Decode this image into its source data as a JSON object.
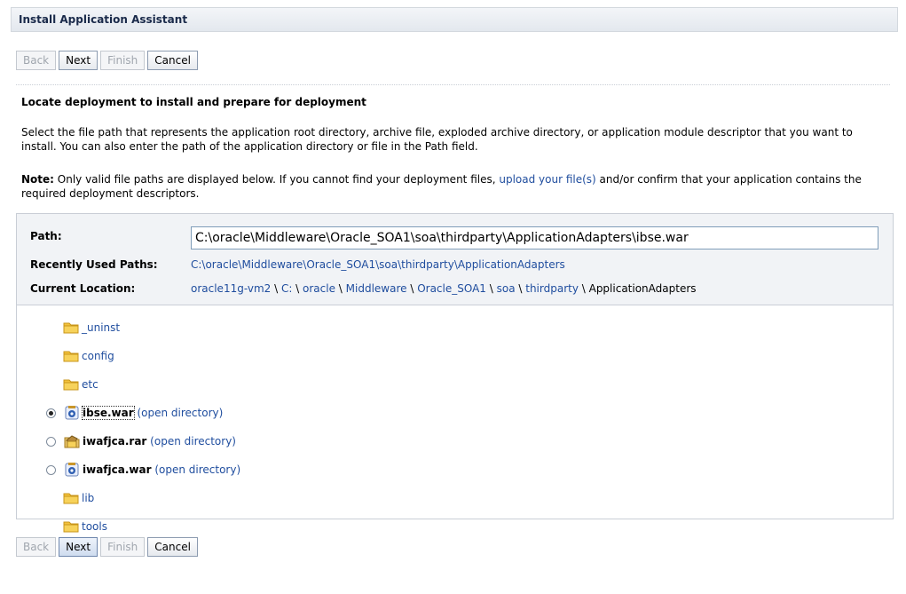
{
  "title": "Install Application Assistant",
  "buttons": {
    "back": "Back",
    "next": "Next",
    "finish": "Finish",
    "cancel": "Cancel"
  },
  "heading": "Locate deployment to install and prepare for deployment",
  "intro": "Select the file path that represents the application root directory, archive file, exploded archive directory, or application module descriptor that you want to install. You can also enter the path of the application directory or file in the Path field.",
  "note": {
    "label": "Note:",
    "text_before": " Only valid file paths are displayed below. If you cannot find your deployment files, ",
    "link": "upload your file(s)",
    "text_after": " and/or confirm that your application contains the required deployment descriptors."
  },
  "path": {
    "label": "Path:",
    "value": "C:\\oracle\\Middleware\\Oracle_SOA1\\soa\\thirdparty\\ApplicationAdapters\\ibse.war"
  },
  "recent": {
    "label": "Recently Used Paths:",
    "value": "C:\\oracle\\Middleware\\Oracle_SOA1\\soa\\thirdparty\\ApplicationAdapters"
  },
  "current": {
    "label": "Current Location:",
    "crumbs": [
      "oracle11g-vm2",
      "C:",
      "oracle",
      "Middleware",
      "Oracle_SOA1",
      "soa",
      "thirdparty"
    ],
    "last": "ApplicationAdapters",
    "separator": " \\ "
  },
  "items": [
    {
      "name": "_uninst",
      "type": "folder"
    },
    {
      "name": "config",
      "type": "folder"
    },
    {
      "name": "etc",
      "type": "folder"
    },
    {
      "name": "ibse.war",
      "type": "war",
      "selected": true,
      "open_label": "(open directory)"
    },
    {
      "name": "iwafjca.rar",
      "type": "rar",
      "selected": false,
      "open_label": "(open directory)"
    },
    {
      "name": "iwafjca.war",
      "type": "war",
      "selected": false,
      "open_label": "(open directory)"
    },
    {
      "name": "lib",
      "type": "folder"
    },
    {
      "name": "tools",
      "type": "folder"
    }
  ],
  "colors": {
    "link": "#1f4d9e",
    "folder": "#f3c23c"
  }
}
